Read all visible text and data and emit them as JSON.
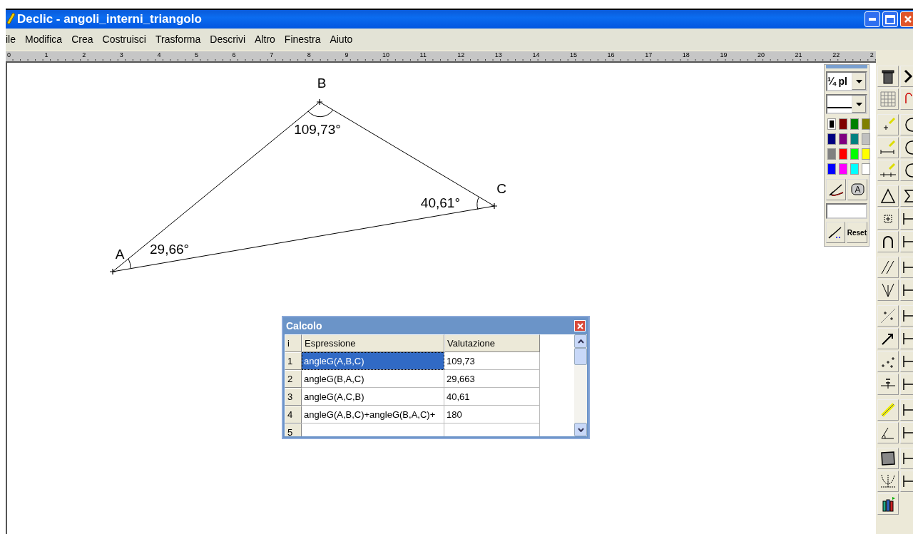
{
  "window": {
    "title": "Declic - angoli_interni_triangolo"
  },
  "menu": [
    "ile",
    "Modifica",
    "Crea",
    "Costruisci",
    "Trasforma",
    "Descrivi",
    "Altro",
    "Finestra",
    "Aiuto"
  ],
  "ruler": [
    "0",
    "1",
    "2",
    "3",
    "4",
    "5",
    "6",
    "7",
    "8",
    "9",
    "10",
    "11",
    "12",
    "13",
    "14",
    "15",
    "16",
    "17",
    "18",
    "19",
    "20",
    "21",
    "22",
    "2"
  ],
  "figure": {
    "points": [
      {
        "name": "A"
      },
      {
        "name": "B"
      },
      {
        "name": "C"
      }
    ],
    "angles": [
      {
        "label": "29,66°"
      },
      {
        "label": "109,73°"
      },
      {
        "label": "40,61°"
      }
    ]
  },
  "palette": {
    "thickness": "¼ pl",
    "reset": "Reset",
    "colors": [
      {
        "color": "#000000",
        "selected": true
      },
      {
        "color": "#800000",
        "selected": false
      },
      {
        "color": "#008000",
        "selected": false
      },
      {
        "color": "#808000",
        "selected": false
      },
      {
        "color": "#000080",
        "selected": false
      },
      {
        "color": "#800080",
        "selected": false
      },
      {
        "color": "#008080",
        "selected": false
      },
      {
        "color": "#c0c0c0",
        "selected": false
      },
      {
        "color": "#808080",
        "selected": false
      },
      {
        "color": "#ff0000",
        "selected": false
      },
      {
        "color": "#00ff00",
        "selected": false
      },
      {
        "color": "#ffff00",
        "selected": false
      },
      {
        "color": "#0000ff",
        "selected": false
      },
      {
        "color": "#ff00ff",
        "selected": false
      },
      {
        "color": "#00ffff",
        "selected": false
      },
      {
        "color": "#ffffff",
        "selected": false
      }
    ]
  },
  "calc": {
    "title": "Calcolo",
    "columns": [
      "i",
      "Espressione",
      "Valutazione"
    ],
    "rows": [
      {
        "index": "1",
        "expression": "angleG(A,B,C)",
        "value": "109,73",
        "selected": true
      },
      {
        "index": "2",
        "expression": "angleG(B,A,C)",
        "value": "29,663",
        "selected": false
      },
      {
        "index": "3",
        "expression": "angleG(A,C,B)",
        "value": "40,61",
        "selected": false
      },
      {
        "index": "4",
        "expression": "angleG(A,B,C)+angleG(B,A,C)+",
        "value": "180",
        "selected": false
      },
      {
        "index": "5",
        "selected": false
      }
    ]
  }
}
